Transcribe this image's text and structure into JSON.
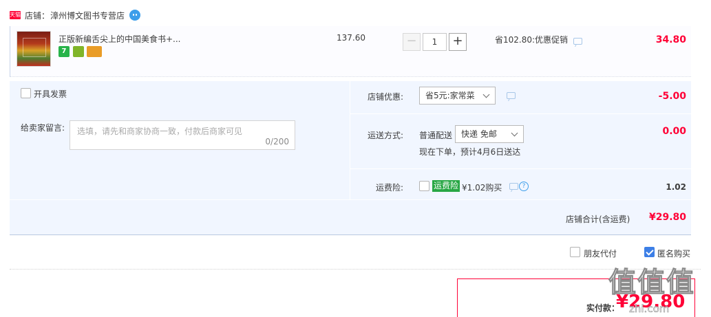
{
  "shop": {
    "badge": "天猫",
    "prefix": "店铺：",
    "name": "漳州博文图书专营店"
  },
  "item": {
    "title": "正版新编舌尖上的中国美食书+...",
    "unit_price": "137.60",
    "quantity": "1",
    "minus": "−",
    "plus": "+",
    "promotion": "省102.80:优惠促销",
    "total": "34.80",
    "services": [
      "7",
      "",
      ""
    ]
  },
  "invoice": {
    "label": "开具发票"
  },
  "message": {
    "label": "给卖家留言:",
    "placeholder": "选填，请先和商家协商一致，付款后商家可见",
    "counter": "0/200"
  },
  "shop_discount": {
    "label": "店铺优惠:",
    "selected": "省5元:家常菜",
    "amount": "-5.00"
  },
  "delivery": {
    "label": "运送方式:",
    "normal": "普通配送",
    "selected": "快递 免邮",
    "eta": "现在下单，预计4月6日送达",
    "amount": "0.00"
  },
  "insurance": {
    "label": "运费险:",
    "badge": "运费险",
    "price": "¥1.02购买",
    "help": "?",
    "amount": "1.02"
  },
  "subtotal": {
    "label": "店铺合计(含运费)",
    "amount": "¥29.80"
  },
  "options": {
    "friend_pay": "朋友代付",
    "anonymous": "匿名购买"
  },
  "payment": {
    "label": "实付款：",
    "amount": "¥29.80"
  },
  "watermark": {
    "text": "值值值",
    "url": "zhi.com"
  },
  "colors": {
    "accent_red": "#ff0036",
    "accent_blue": "#3d9eea",
    "panel_bg": "#f1f6ff",
    "insurance_green": "#28a745"
  }
}
